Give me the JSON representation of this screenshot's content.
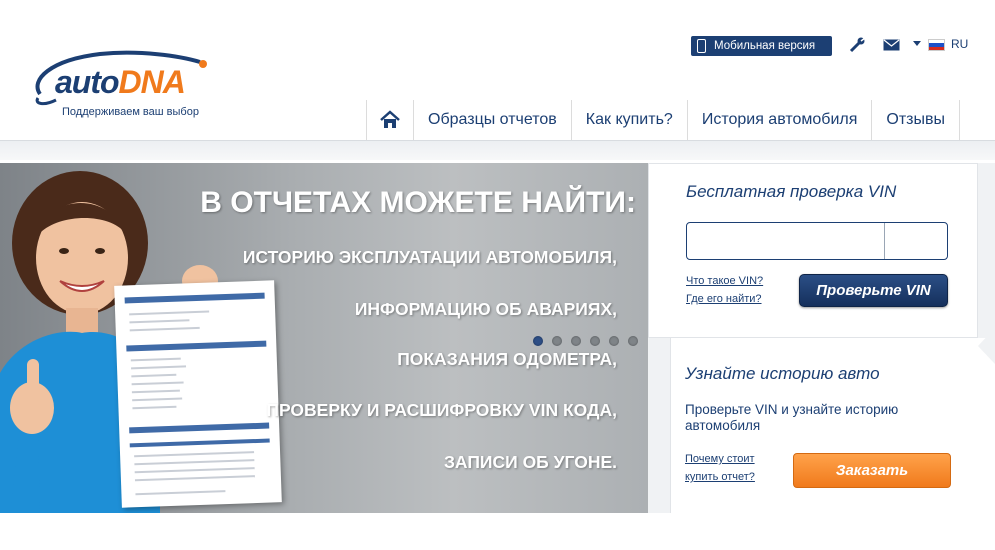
{
  "header": {
    "logo_auto": "auto",
    "logo_dna": "DNA",
    "tagline": "Поддерживаем ваш выбор",
    "mobile_label": "Мобильная версия",
    "lang": "RU"
  },
  "nav": {
    "items": [
      {
        "label": "Образцы отчетов"
      },
      {
        "label": "Как купить?"
      },
      {
        "label": "История автомобиля"
      },
      {
        "label": "Отзывы"
      }
    ]
  },
  "banner": {
    "title": "В ОТЧЕТАХ МОЖЕТЕ НАЙТИ:",
    "lines": [
      "ИСТОРИЮ ЭКСПЛУАТАЦИИ АВТОМОБИЛЯ,",
      "ИНФОРМАЦИЮ ОБ АВАРИЯХ,",
      "ПОКАЗАНИЯ ОДОМЕТРА,",
      "ПРОВЕРКУ И РАСШИФРОВКУ VIN КОДА,",
      "ЗАПИСИ ОБ УГОНЕ."
    ],
    "slides_active": 1,
    "slides_total": 6
  },
  "vin_check": {
    "title": "Бесплатная проверка VIN",
    "input_value": "",
    "link_what": "Что такое VIN?",
    "link_where": "Где его найти?",
    "button": "Проверьте VIN"
  },
  "history": {
    "title": "Узнайте историю авто",
    "description": "Проверьте VIN и узнайте историю автомобиля",
    "link_line1": "Почему стоит",
    "link_line2": "купить отчет?",
    "button": "Заказать"
  },
  "colors": {
    "brand_blue": "#1c3f73",
    "brand_orange": "#f07a1c"
  }
}
